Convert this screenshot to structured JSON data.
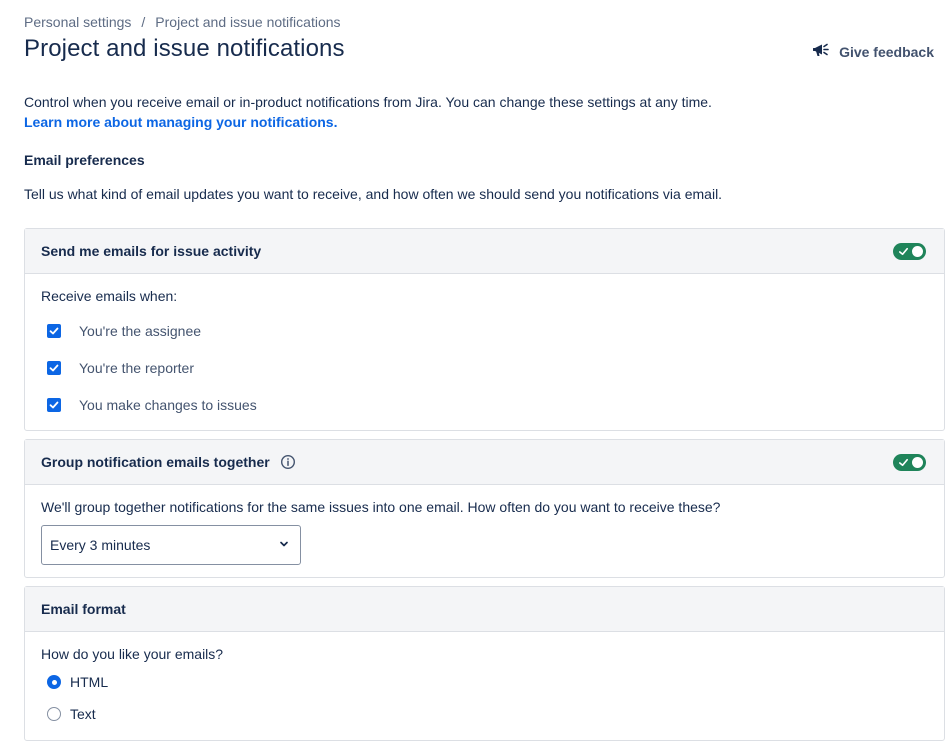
{
  "breadcrumb": {
    "parent": "Personal settings",
    "separator": "/",
    "current": "Project and issue notifications"
  },
  "page_title": "Project and issue notifications",
  "feedback": {
    "label": "Give feedback",
    "icon": "megaphone-icon"
  },
  "intro": {
    "text": "Control when you receive email or in-product notifications from Jira. You can change these settings at any time.",
    "link": "Learn more about managing your notifications."
  },
  "email_preferences": {
    "heading": "Email preferences",
    "description": "Tell us what kind of email updates you want to receive, and how often we should send you notifications via email."
  },
  "issue_activity": {
    "title": "Send me emails for issue activity",
    "enabled": true,
    "prompt": "Receive emails when:",
    "options": [
      {
        "label": "You're the assignee",
        "checked": true
      },
      {
        "label": "You're the reporter",
        "checked": true
      },
      {
        "label": "You make changes to issues",
        "checked": true
      }
    ]
  },
  "grouping": {
    "title": "Group notification emails together",
    "enabled": true,
    "description": "We'll group together notifications for the same issues into one email. How often do you want to receive these?",
    "selected": "Every 3 minutes"
  },
  "email_format": {
    "title": "Email format",
    "prompt": "How do you like your emails?",
    "options": [
      {
        "label": "HTML",
        "selected": true
      },
      {
        "label": "Text",
        "selected": false
      }
    ]
  },
  "colors": {
    "toggle_on": "#1f845a",
    "accent": "#0c66e4",
    "link": "#0c66e4"
  }
}
